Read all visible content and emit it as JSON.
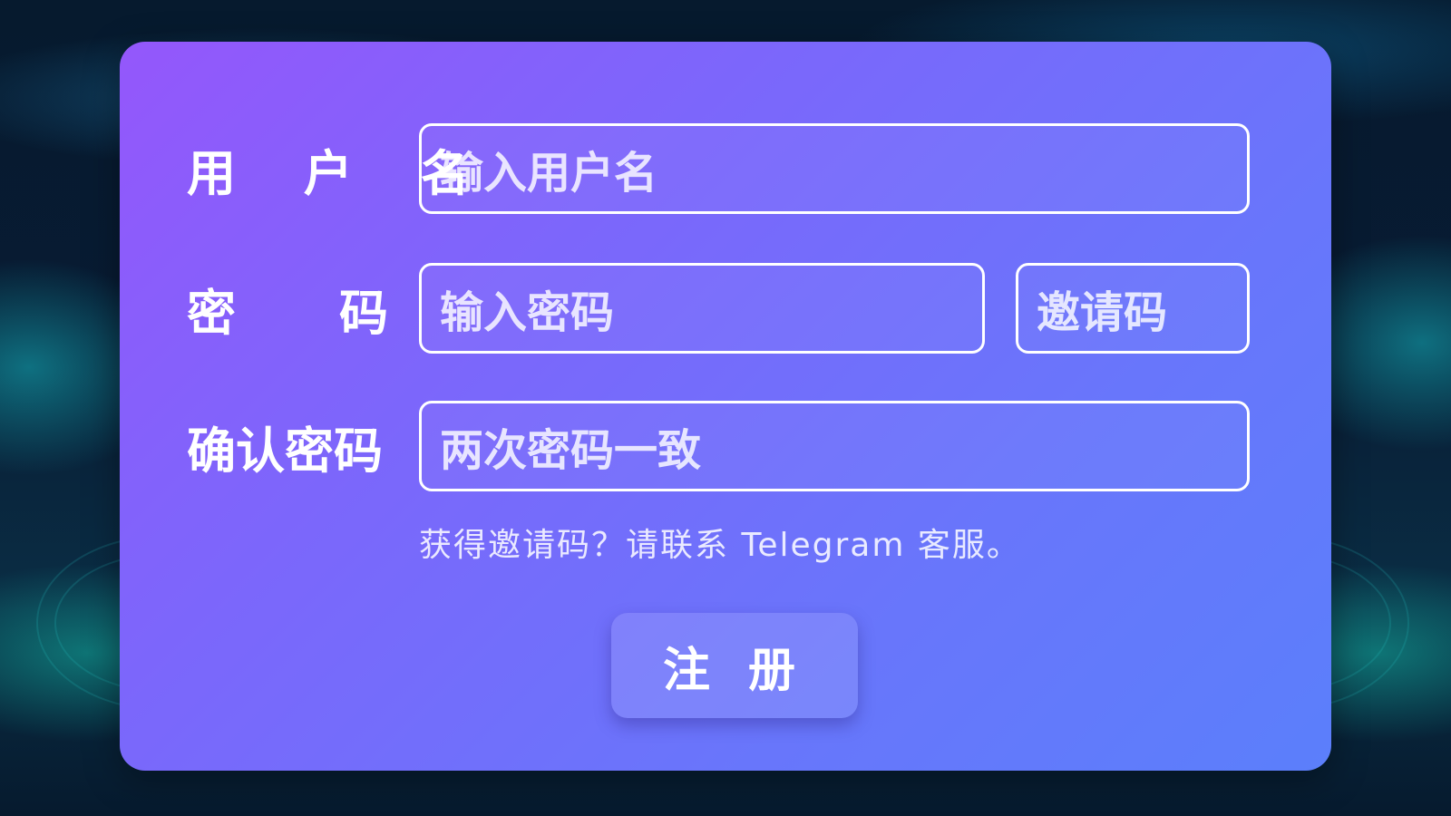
{
  "form": {
    "username": {
      "label": "用 户 名",
      "placeholder": "输入用户名"
    },
    "password": {
      "label_left": "密",
      "label_right": "码",
      "placeholder": "输入密码"
    },
    "invite_code": {
      "placeholder": "邀请码"
    },
    "confirm_password": {
      "label": "确认密码",
      "placeholder": "两次密码一致"
    },
    "hint": "获得邀请码？请联系 Telegram 客服。",
    "submit_label": "注 册"
  },
  "colors": {
    "card_gradient_start": "#9457fb",
    "card_gradient_end": "#5b7ffb",
    "field_border": "#ffffff",
    "text": "#ffffff",
    "background": "#081b33"
  }
}
